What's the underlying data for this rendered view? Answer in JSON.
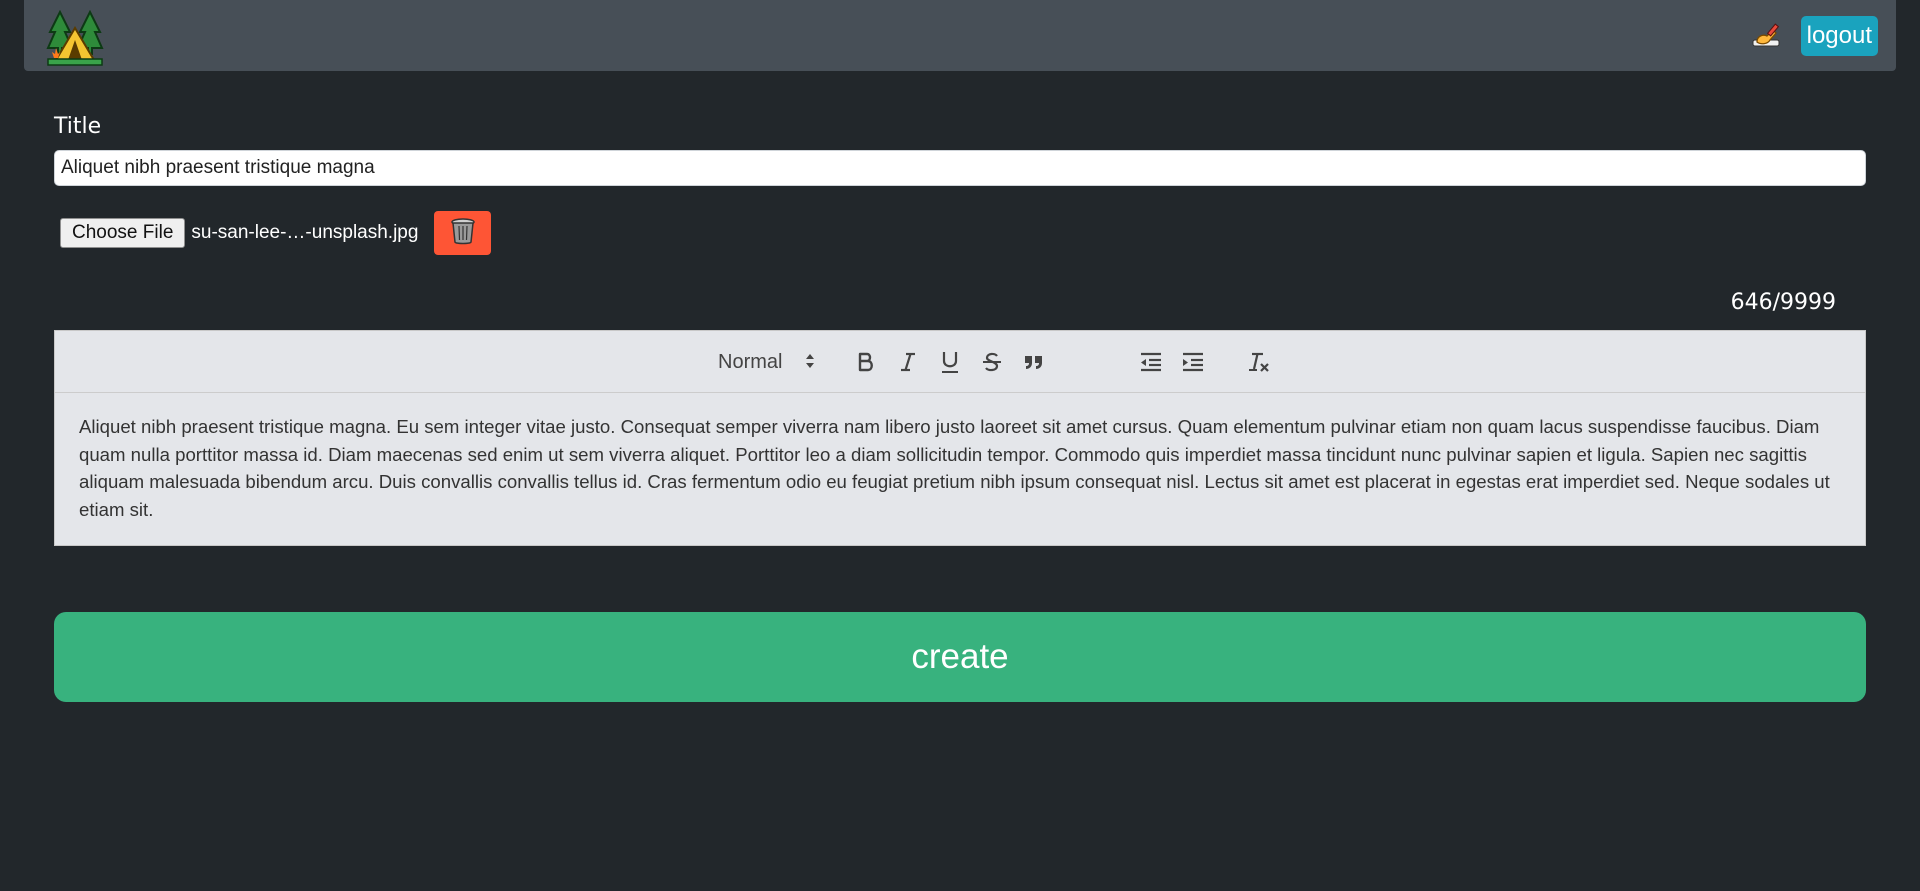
{
  "navbar": {
    "logo_icon": "camping-tent-icon",
    "write_icon": "writing-hand-icon",
    "logout_label": "logout"
  },
  "form": {
    "title_label": "Title",
    "title_value": "Aliquet nibh praesent tristique magna",
    "choose_file_label": "Choose File",
    "file_name": "su-san-lee-…-unsplash.jpg",
    "delete_icon": "trash-can-icon",
    "char_counter": "646/9999"
  },
  "editor": {
    "heading_select_value": "Normal",
    "toolbar": [
      "bold-icon",
      "italic-icon",
      "underline-icon",
      "strikethrough-icon",
      "blockquote-icon",
      "outdent-icon",
      "indent-icon",
      "clear-format-icon"
    ],
    "content": "Aliquet nibh praesent tristique magna. Eu sem integer vitae justo. Consequat semper viverra nam libero justo laoreet sit amet cursus. Quam elementum pulvinar etiam non quam lacus suspendisse faucibus. Diam quam nulla porttitor massa id. Diam maecenas sed enim ut sem viverra aliquet. Porttitor leo a diam sollicitudin tempor. Commodo quis imperdiet massa tincidunt nunc pulvinar sapien et ligula. Sapien nec sagittis aliquam malesuada bibendum arcu. Duis convallis convallis tellus id. Cras fermentum odio eu feugiat pretium nibh ipsum consequat nisl. Lectus sit amet est placerat in egestas erat imperdiet sed. Neque sodales ut etiam sit."
  },
  "create_label": "create",
  "colors": {
    "background": "#22272b",
    "navbar": "#474f57",
    "logout": "#1aa3be",
    "delete": "#fe5535",
    "create": "#38b27e",
    "editor_bg": "#e4e6ea"
  }
}
